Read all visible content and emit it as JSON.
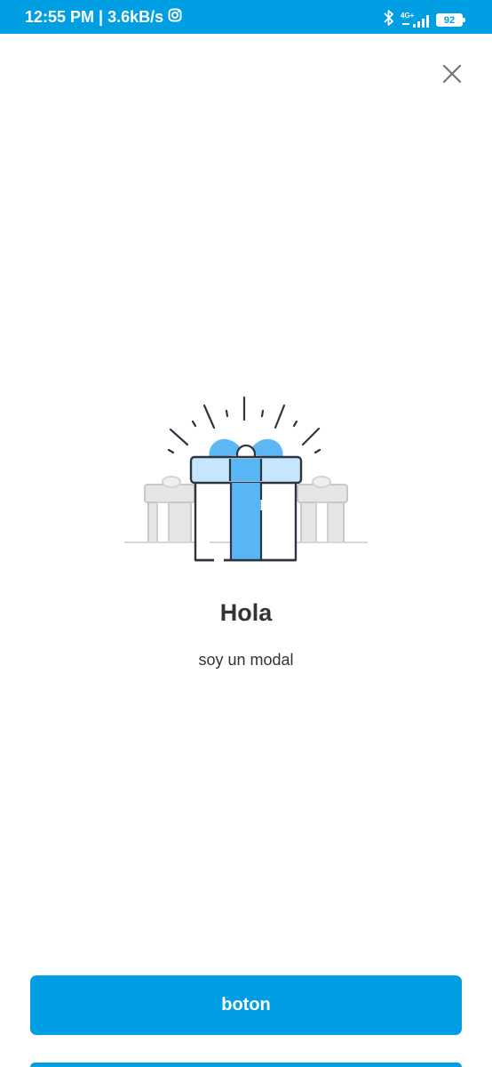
{
  "status_bar": {
    "time": "12:55 PM",
    "separator": "|",
    "speed": "3.6kB/s",
    "app_icon": "instagram-icon",
    "network_type": "4G+",
    "battery_level": "92",
    "background_color": "#009ee3"
  },
  "modal": {
    "close_icon": "close-icon",
    "illustration": "gift-boxes-illustration",
    "title": "Hola",
    "text": "soy un modal",
    "button_label": "boton",
    "accent_color": "#009ee3"
  }
}
